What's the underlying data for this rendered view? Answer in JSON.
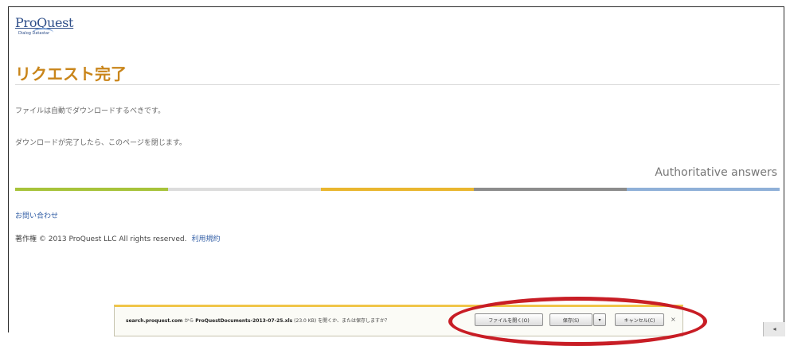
{
  "logo": {
    "main_text": "ProQuest",
    "sub_text": "Dialog Datastar"
  },
  "page": {
    "title": "リクエスト完了",
    "message_1": "ファイルは自動でダウンロードするべきです。",
    "message_2": "ダウンロードが完了したら、このページを閉じます。",
    "tagline": "Authoritative answers",
    "contact_link": "お問い合わせ",
    "copyright": "著作権 © 2013 ProQuest LLC All rights reserved.",
    "terms_link": "利用規約"
  },
  "color_bar": {
    "colors": [
      "#a7c33a",
      "#dcdcdc",
      "#e9b62e",
      "#8c8c8c",
      "#8fb0d8"
    ]
  },
  "download_bar": {
    "site": "search.proquest.com",
    "from_text": "から",
    "filename": "ProQuestDocuments-2013-07-25.xls",
    "info_text": "(23.0 KB) を開くか、または保存しますか？",
    "open_label": "ファイルを開く(O)",
    "save_label": "保存(S)",
    "save_arrow": "▾",
    "cancel_label": "キャンセル(C)",
    "close_label": "×"
  },
  "scroll_tab": {
    "label": "◂"
  }
}
